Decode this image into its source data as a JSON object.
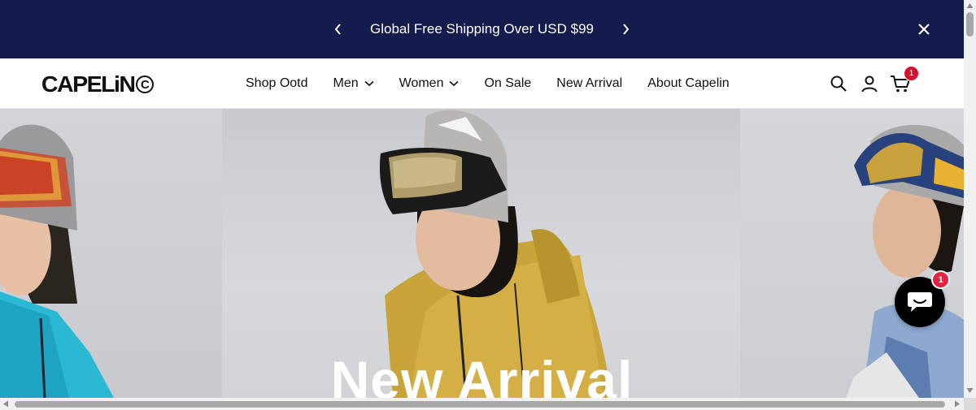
{
  "announcement": {
    "message": "Global Free Shipping Over USD $99",
    "prev_icon": "chevron-left-icon",
    "next_icon": "chevron-right-icon",
    "close_icon": "close-icon",
    "background": "#141b4d"
  },
  "header": {
    "logo_text": "CAPELiN",
    "logo_mark": "C",
    "nav": [
      {
        "label": "Shop Ootd",
        "has_dropdown": false
      },
      {
        "label": "Men",
        "has_dropdown": true
      },
      {
        "label": "Women",
        "has_dropdown": true
      },
      {
        "label": "On Sale",
        "has_dropdown": false
      },
      {
        "label": "New Arrival",
        "has_dropdown": false
      },
      {
        "label": "About Capelin",
        "has_dropdown": false
      }
    ],
    "icons": [
      "search-icon",
      "account-icon",
      "cart-icon"
    ],
    "cart_count": "1",
    "badge_color": "#d6112b"
  },
  "hero": {
    "title": "New Arrival"
  },
  "chat": {
    "icon": "chat-icon",
    "unread_count": "1"
  }
}
